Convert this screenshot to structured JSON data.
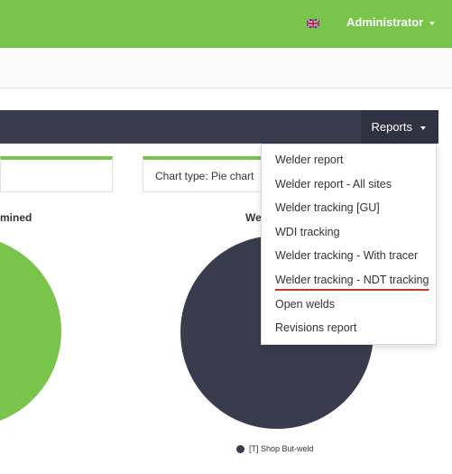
{
  "header": {
    "user_label": "Administrator",
    "flag_icon": "uk-flag-icon",
    "bg_color": "#79c44b"
  },
  "toolbar": {
    "reports_label": "Reports",
    "bg_color": "#383c4c"
  },
  "filters": {
    "chart_type_label": "Chart type: Pie chart"
  },
  "charts": {
    "left_title_fragment": "mined",
    "right_title_fragment": "We",
    "left_color": "#79c44b",
    "right_color": "#383c4c",
    "right_legend": "[T] Shop But-weld"
  },
  "reports_menu": {
    "items": [
      "Welder report",
      "Welder report - All sites",
      "Welder tracking [GU]",
      "WDI tracking",
      "Welder tracking - With tracer",
      "Welder tracking - NDT tracking",
      "Open welds",
      "Revisions report"
    ],
    "highlighted_index": 5
  }
}
